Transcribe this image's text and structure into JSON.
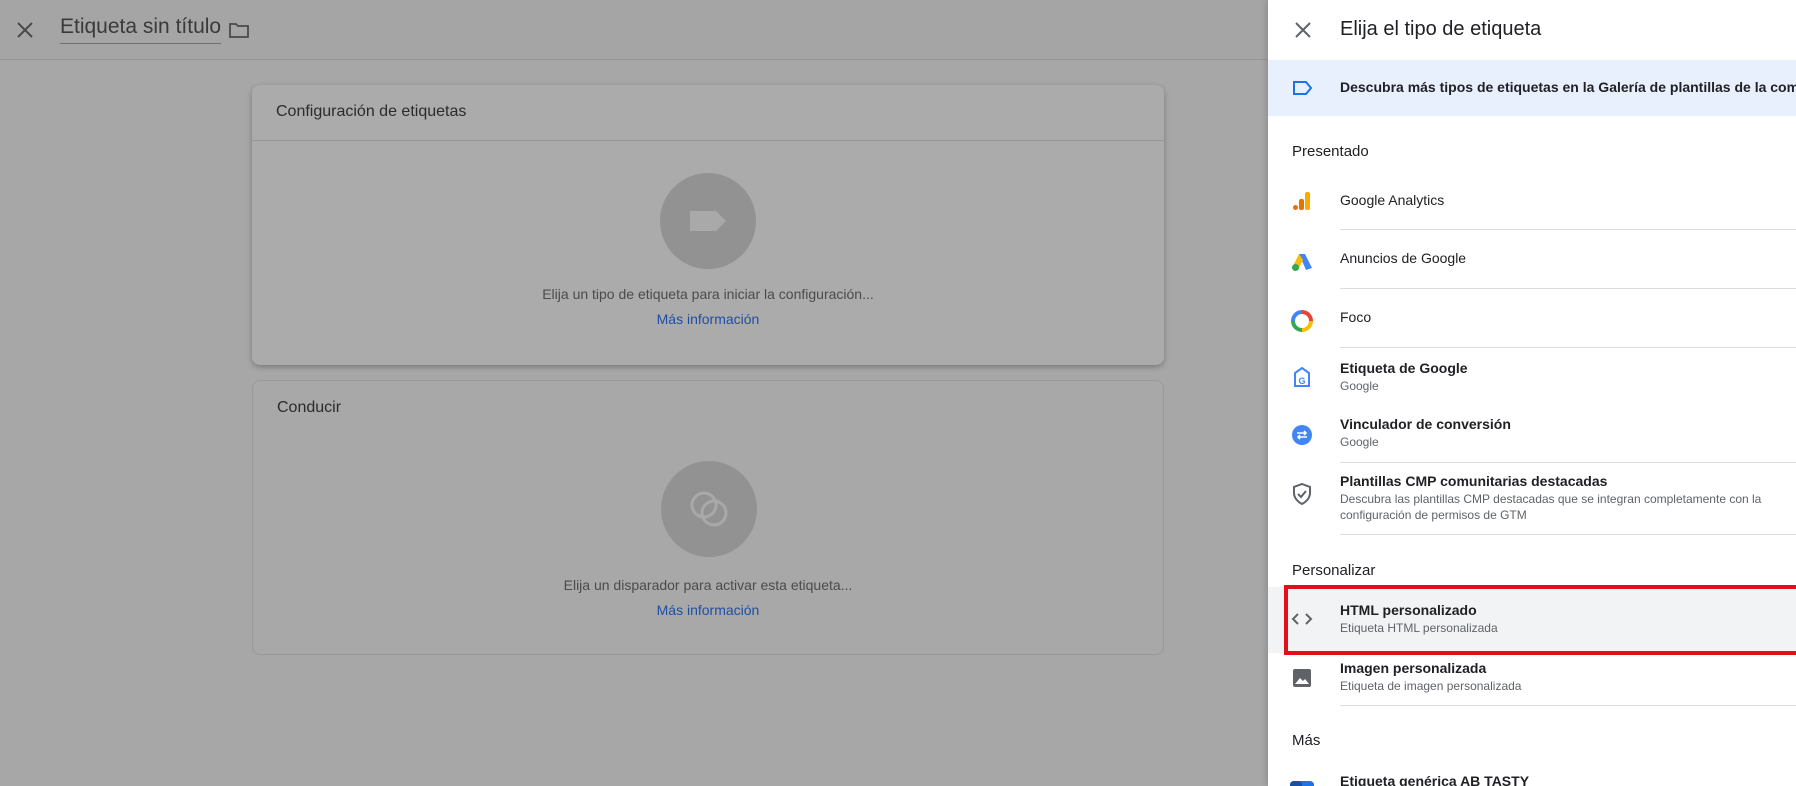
{
  "editor": {
    "title": "Etiqueta sin título",
    "tag_card": {
      "title": "Configuración de etiquetas",
      "hint": "Elija un tipo de etiqueta para iniciar la configuración...",
      "more": "Más información"
    },
    "trigger_card": {
      "title": "Conducir",
      "hint": "Elija un disparador para activar esta etiqueta...",
      "more": "Más información"
    }
  },
  "panel": {
    "title": "Elija el tipo de etiqueta",
    "banner": "Descubra más tipos de etiquetas en la Galería de plantillas de la comunidad",
    "sections": {
      "featured": "Presentado",
      "custom": "Personalizar",
      "more": "Más"
    },
    "featured_items": [
      {
        "name": "Google Analytics",
        "icon": "google-analytics-icon"
      },
      {
        "name": "Anuncios de Google",
        "icon": "google-ads-icon"
      },
      {
        "name": "Foco",
        "icon": "floodlight-icon"
      },
      {
        "name": "Etiqueta de Google",
        "sub": "Google",
        "icon": "google-tag-icon"
      },
      {
        "name": "Vinculador de conversión",
        "sub": "Google",
        "icon": "conversion-linker-icon"
      },
      {
        "name": "Plantillas CMP comunitarias destacadas",
        "sub": "Descubra las plantillas CMP destacadas que se integran completamente con la configuración de permisos de GTM",
        "icon": "shield-check-icon"
      }
    ],
    "custom_items": [
      {
        "name": "HTML personalizado",
        "sub": "Etiqueta HTML personalizada",
        "icon": "code-icon"
      },
      {
        "name": "Imagen personalizada",
        "sub": "Etiqueta de imagen personalizada",
        "icon": "image-icon"
      }
    ],
    "more_items": [
      {
        "name": "Etiqueta genérica AB TASTY",
        "icon": "ab-tasty-icon"
      }
    ]
  },
  "colors": {
    "highlight": "#e3101b",
    "link": "#1a73e8",
    "banner_bg": "#e8f0fe"
  }
}
